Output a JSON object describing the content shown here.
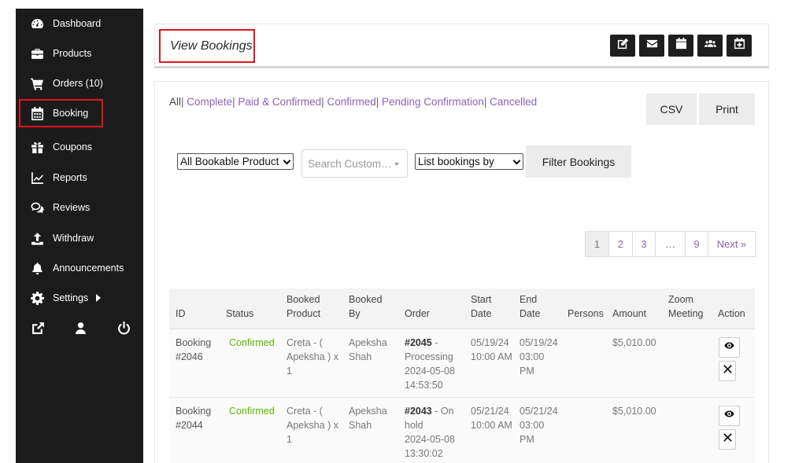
{
  "sidebar": {
    "items": [
      {
        "label": "Dashboard",
        "icon": "tachometer-icon"
      },
      {
        "label": "Products",
        "icon": "briefcase-icon"
      },
      {
        "label": "Orders (10)",
        "icon": "cart-icon"
      },
      {
        "label": "Booking",
        "icon": "calendar-icon"
      },
      {
        "label": "Coupons",
        "icon": "gift-icon"
      },
      {
        "label": "Reports",
        "icon": "chart-icon"
      },
      {
        "label": "Reviews",
        "icon": "comments-icon"
      },
      {
        "label": "Withdraw",
        "icon": "upload-icon"
      },
      {
        "label": "Announcements",
        "icon": "bell-icon"
      },
      {
        "label": "Settings",
        "icon": "cog-icon"
      }
    ],
    "active_item": "Booking",
    "bottom_icons": [
      "external-link-icon",
      "user-icon",
      "power-icon"
    ],
    "colors": {
      "background": "#1b1b1b",
      "active_border": "#e0161b"
    }
  },
  "header": {
    "title": "View Bookings",
    "buttons": [
      "edit-icon",
      "envelope-icon",
      "calendar-icon",
      "users-icon",
      "calendar-plus-icon"
    ]
  },
  "filters": {
    "status_links": [
      {
        "label": "All",
        "active": true
      },
      {
        "label": "Complete"
      },
      {
        "label": "Paid & Confirmed"
      },
      {
        "label": "Confirmed"
      },
      {
        "label": "Pending Confirmation"
      },
      {
        "label": "Cancelled"
      }
    ],
    "csv_label": "CSV",
    "print_label": "Print",
    "product_select": "All Bookable Product",
    "customer_search_placeholder": "Search Custom…",
    "list_by_select": "List bookings by",
    "filter_button": "Filter Bookings"
  },
  "pagination": {
    "pages": [
      "1",
      "2",
      "3",
      "…",
      "9"
    ],
    "current": "1",
    "next_label": "Next »"
  },
  "table": {
    "headers": {
      "id": "ID",
      "status": "Status",
      "booked_product": "Booked Product",
      "booked_by": "Booked By",
      "order": "Order",
      "start_date": "Start Date",
      "end_date": "End Date",
      "persons": "Persons",
      "amount": "Amount",
      "zoom_meeting": "Zoom Meeting",
      "action": "Action"
    },
    "rows": [
      {
        "id": "Booking #2046",
        "status": "Confirmed",
        "product": "Creta - ( Apeksha ) x 1",
        "booked_by": "Apeksha Shah",
        "order_no": "#2045",
        "order_status": " - Processing",
        "order_date": "2024-05-08 14:53:50",
        "start_date": "05/19/24 10:00 AM",
        "end_date": "05/19/24 03:00 PM",
        "persons": "",
        "amount": "$5,010.00",
        "zoom": ""
      },
      {
        "id": "Booking #2044",
        "status": "Confirmed",
        "product": "Creta - ( Apeksha ) x 1",
        "booked_by": "Apeksha Shah",
        "order_no": "#2043",
        "order_status": " - On hold",
        "order_date": "2024-05-08 13:30:02",
        "start_date": "05/21/24 10:00 AM",
        "end_date": "05/21/24 03:00 PM",
        "persons": "",
        "amount": "$5,010.00",
        "zoom": ""
      }
    ],
    "colors": {
      "status_confirmed": "#5cb800",
      "link": "#8a63b5"
    }
  }
}
